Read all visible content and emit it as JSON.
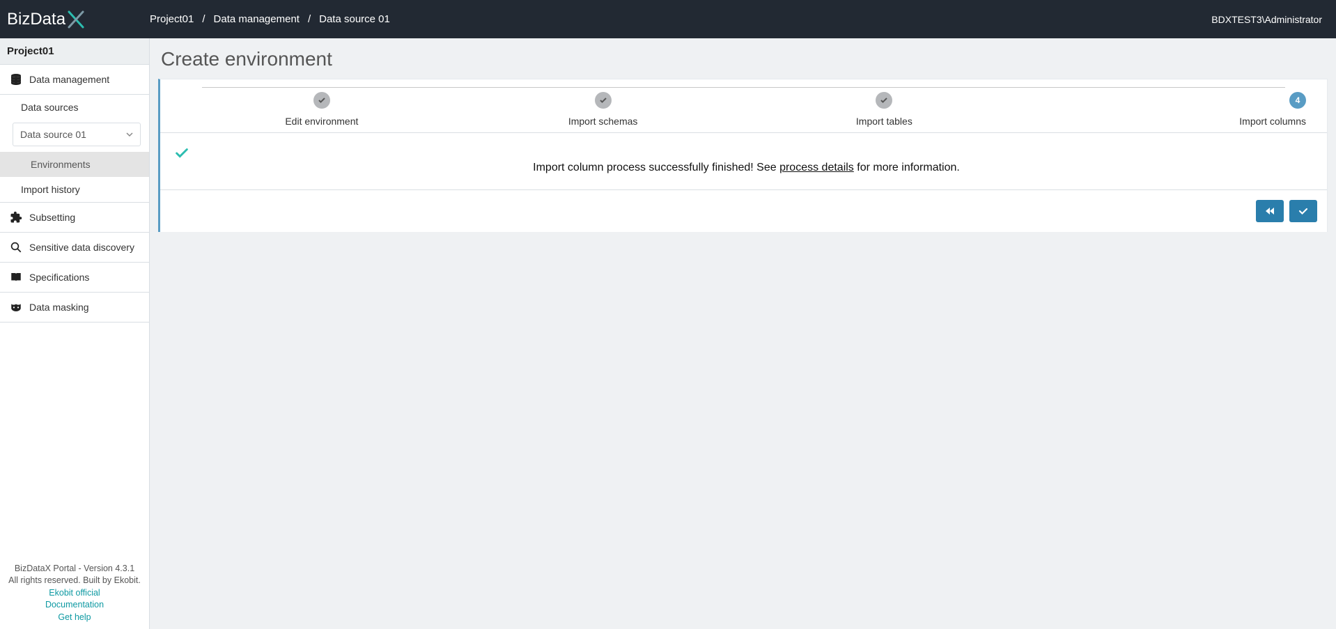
{
  "header": {
    "logo_text": "BizData",
    "breadcrumbs": [
      "Project01",
      "Data management",
      "Data source 01"
    ],
    "user": "BDXTEST3\\Administrator"
  },
  "sidebar": {
    "project": "Project01",
    "items": [
      {
        "id": "data-management",
        "label": "Data management",
        "icon": "database"
      },
      {
        "id": "subsetting",
        "label": "Subsetting",
        "icon": "puzzle"
      },
      {
        "id": "sensitive-discovery",
        "label": "Sensitive data discovery",
        "icon": "search"
      },
      {
        "id": "specifications",
        "label": "Specifications",
        "icon": "book"
      },
      {
        "id": "data-masking",
        "label": "Data masking",
        "icon": "mask"
      }
    ],
    "data_mgmt": {
      "data_sources_label": "Data sources",
      "selected_source": "Data source 01",
      "environments_label": "Environments",
      "import_history_label": "Import history"
    },
    "footer": {
      "line1": "BizDataX Portal - Version 4.3.1",
      "line2": "All rights reserved. Built by Ekobit.",
      "links": [
        "Ekobit official",
        "Documentation",
        "Get help"
      ]
    }
  },
  "main": {
    "title": "Create environment",
    "steps": [
      {
        "label": "Edit environment",
        "state": "done"
      },
      {
        "label": "Import schemas",
        "state": "done"
      },
      {
        "label": "Import tables",
        "state": "done"
      },
      {
        "label": "Import columns",
        "state": "active",
        "number": "4"
      }
    ],
    "status": {
      "prefix": "Import column process successfully finished! See ",
      "link": "process details",
      "suffix": " for more information."
    }
  }
}
